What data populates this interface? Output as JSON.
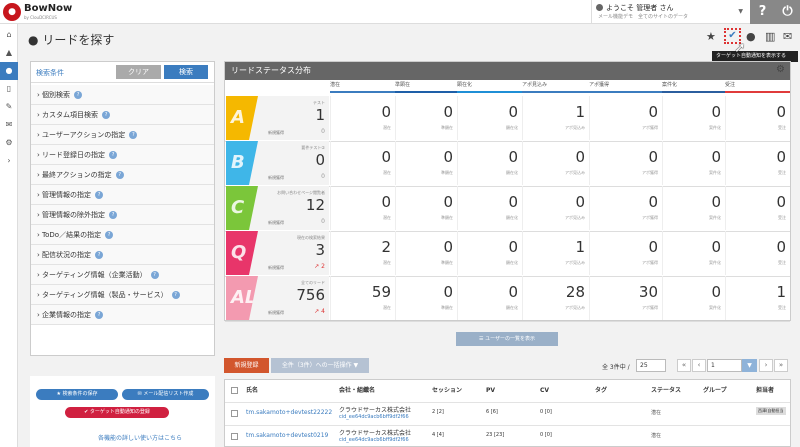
{
  "header": {
    "app_name": "BowNow",
    "app_sub": "by ClouDCIRCUS",
    "greeting": "ようこそ 管理者 さん",
    "user_org": "メール機能デモ　全てのサイトのデータ",
    "help_icon": "?",
    "power_icon": "⏻"
  },
  "page": {
    "title": "リードを探す",
    "tooltip": "ターゲット自動通知を表示する",
    "accent": "#3b7cbf"
  },
  "search": {
    "label": "検索条件",
    "clear": "クリア",
    "search": "検索",
    "criteria": [
      "個別検索",
      "カスタム項目検索",
      "ユーザーアクションの指定",
      "リード登録日の指定",
      "最終アクションの指定",
      "管理情報の指定",
      "管理情報の除外指定",
      "ToDo／結果の指定",
      "配信状況の指定",
      "ターゲティング情報（企業活動）",
      "ターゲティング情報（製品・サービス）",
      "企業情報の指定"
    ],
    "save_conditions": "検索条件の保存",
    "create_mail_list": "メール配信リスト作成",
    "register_target": "ターゲット自動通知の登録",
    "help_link": "各機能の詳しい使い方はこちら"
  },
  "status": {
    "title": "リードステータス分布",
    "columns": [
      "潜在",
      "準顕在",
      "顕在化",
      "アポ見込み",
      "アポ獲得",
      "案件化",
      "受注"
    ],
    "rows": [
      {
        "name": "テスト",
        "sub": "新規獲得",
        "total": "1",
        "new": "0",
        "new_red": false,
        "color": "#f5b800",
        "letter": "A",
        "values": [
          "0",
          "0",
          "0",
          "1",
          "0",
          "0",
          "0"
        ]
      },
      {
        "name": "要件テスト②",
        "sub": "新規獲得",
        "total": "0",
        "new": "0",
        "new_red": false,
        "color": "#3fb6e8",
        "letter": "B",
        "values": [
          "0",
          "0",
          "0",
          "0",
          "0",
          "0",
          "0"
        ]
      },
      {
        "name": "お問い合わせページ閲覧者",
        "sub": "新規獲得",
        "total": "12",
        "new": "0",
        "new_red": false,
        "color": "#7bc63a",
        "letter": "C",
        "values": [
          "0",
          "0",
          "0",
          "0",
          "0",
          "0",
          "0"
        ]
      },
      {
        "name": "現在の検索結果",
        "sub": "新規獲得",
        "total": "3",
        "new": "↗ 2",
        "new_red": true,
        "color": "#e8356a",
        "letter": "Q",
        "values": [
          "2",
          "0",
          "0",
          "1",
          "0",
          "0",
          "0"
        ]
      },
      {
        "name": "全てのリード",
        "sub": "新規獲得",
        "total": "756",
        "new": "↗ 4",
        "new_red": true,
        "color": "#f39ab0",
        "letter": "ALL",
        "values": [
          "59",
          "0",
          "0",
          "28",
          "30",
          "0",
          "1"
        ]
      }
    ],
    "show_list_button": "ユーザーの一覧を表示"
  },
  "list": {
    "new_button": "新規登録",
    "bulk_button": "全件（3件）への一括操作",
    "total": "全 3件中 /",
    "page_size": "25",
    "page": "1",
    "headers": [
      "氏名",
      "会社・組織名",
      "セッション",
      "PV",
      "CV",
      "タグ",
      "ステータス",
      "グループ",
      "担当者"
    ],
    "rows": [
      {
        "name": "tm.sakamoto+devtest22222",
        "company": "クラウドサーカス株式会社",
        "cid": "cid_ee64dc9acb6bff9df2f66",
        "session": "2 [2]",
        "pv": "6 [6]",
        "cv": "0 [0]",
        "status": "潜在",
        "owner": "西澤(自動担当"
      },
      {
        "name": "tm.sakamoto+devtest0219",
        "company": "クラウドサーカス株式会社",
        "cid": "cid_ee64dc9acb6bff9df2f66",
        "session": "4 [4]",
        "pv": "23 [23]",
        "cv": "0 [0]",
        "status": "潜在",
        "owner": ""
      }
    ]
  }
}
